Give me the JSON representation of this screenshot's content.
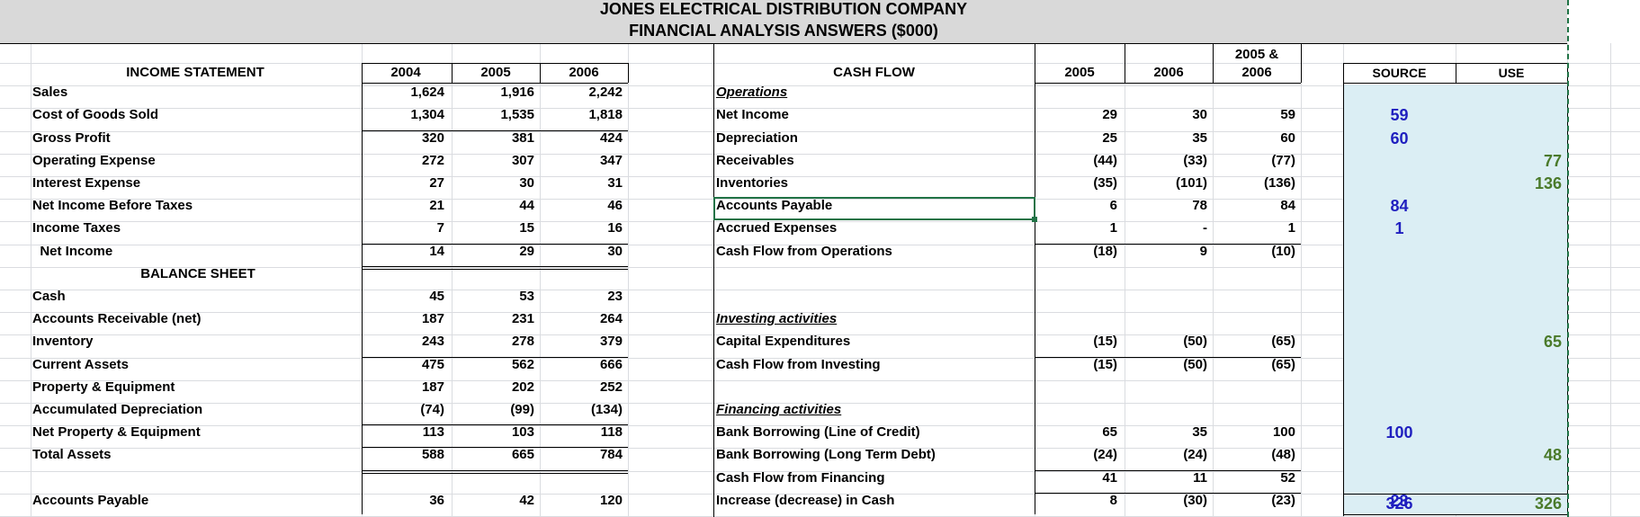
{
  "header": {
    "line1": "JONES ELECTRICAL  DISTRIBUTION COMPANY",
    "line2": "FINANCIAL ANALYSIS ANSWERS ($000)"
  },
  "income": {
    "heading": "INCOME STATEMENT",
    "years": [
      "2004",
      "2005",
      "2006"
    ],
    "rows": [
      {
        "label": "Sales",
        "values": [
          "1,624",
          "1,916",
          "2,242"
        ]
      },
      {
        "label": "Cost of Goods Sold",
        "values": [
          "1,304",
          "1,535",
          "1,818"
        ]
      },
      {
        "label": "Gross Profit",
        "values": [
          "320",
          "381",
          "424"
        ]
      },
      {
        "label": "Operating Expense",
        "values": [
          "272",
          "307",
          "347"
        ]
      },
      {
        "label": "Interest Expense",
        "values": [
          "27",
          "30",
          "31"
        ]
      },
      {
        "label": "Net Income Before Taxes",
        "values": [
          "21",
          "44",
          "46"
        ]
      },
      {
        "label": "Income Taxes",
        "values": [
          "7",
          "15",
          "16"
        ]
      },
      {
        "label": "  Net Income",
        "values": [
          "14",
          "29",
          "30"
        ]
      }
    ]
  },
  "balance": {
    "heading": "BALANCE SHEET",
    "rows": [
      {
        "label": "Cash",
        "values": [
          "45",
          "53",
          "23"
        ]
      },
      {
        "label": "Accounts Receivable (net)",
        "values": [
          "187",
          "231",
          "264"
        ]
      },
      {
        "label": "Inventory",
        "values": [
          "243",
          "278",
          "379"
        ]
      },
      {
        "label": "Current Assets",
        "values": [
          "475",
          "562",
          "666"
        ]
      },
      {
        "label": "Property & Equipment",
        "values": [
          "187",
          "202",
          "252"
        ]
      },
      {
        "label": "Accumulated Depreciation",
        "values": [
          "(74)",
          "(99)",
          "(134)"
        ]
      },
      {
        "label": "Net Property & Equipment",
        "values": [
          "113",
          "103",
          "118"
        ]
      },
      {
        "label": "Total Assets",
        "values": [
          "588",
          "665",
          "784"
        ]
      },
      {
        "label": "",
        "values": [
          "",
          "",
          ""
        ]
      },
      {
        "label": "Accounts Payable",
        "values": [
          "36",
          "42",
          "120"
        ]
      }
    ]
  },
  "cashflow": {
    "heading": "CASH FLOW",
    "years": [
      "2005",
      "2006",
      "2005 &",
      "2006"
    ],
    "rows": [
      {
        "label": "Operations",
        "section": true,
        "values": [
          "",
          "",
          ""
        ],
        "source": "",
        "use": ""
      },
      {
        "label": "Net Income",
        "values": [
          "29",
          "30",
          "59"
        ],
        "source": "59",
        "use": ""
      },
      {
        "label": "Depreciation",
        "values": [
          "25",
          "35",
          "60"
        ],
        "source": "60",
        "use": ""
      },
      {
        "label": "Receivables",
        "values": [
          "(44)",
          "(33)",
          "(77)"
        ],
        "source": "",
        "use": "77"
      },
      {
        "label": "Inventories",
        "values": [
          "(35)",
          "(101)",
          "(136)"
        ],
        "source": "",
        "use": "136"
      },
      {
        "label": "Accounts Payable",
        "values": [
          "6",
          "78",
          "84"
        ],
        "source": "84",
        "use": ""
      },
      {
        "label": "Accrued Expenses",
        "values": [
          "1",
          "-",
          "1"
        ],
        "source": "1",
        "use": ""
      },
      {
        "label": "Cash Flow from Operations",
        "values": [
          "(18)",
          "9",
          "(10)"
        ],
        "source": "",
        "use": ""
      },
      {
        "label": "",
        "values": [
          "",
          "",
          ""
        ],
        "source": "",
        "use": ""
      },
      {
        "label": "",
        "values": [
          "",
          "",
          ""
        ],
        "source": "",
        "use": ""
      },
      {
        "label": "Investing activities",
        "section": true,
        "values": [
          "",
          "",
          ""
        ],
        "source": "",
        "use": ""
      },
      {
        "label": "Capital Expenditures",
        "values": [
          "(15)",
          "(50)",
          "(65)"
        ],
        "source": "",
        "use": "65"
      },
      {
        "label": "Cash Flow from Investing",
        "values": [
          "(15)",
          "(50)",
          "(65)"
        ],
        "source": "",
        "use": ""
      },
      {
        "label": "",
        "values": [
          "",
          "",
          ""
        ],
        "source": "",
        "use": ""
      },
      {
        "label": "Financing activities",
        "section": true,
        "values": [
          "",
          "",
          ""
        ],
        "source": "",
        "use": ""
      },
      {
        "label": "Bank Borrowing (Line of Credit)",
        "values": [
          "65",
          "35",
          "100"
        ],
        "source": "100",
        "use": ""
      },
      {
        "label": "Bank Borrowing (Long Term Debt)",
        "values": [
          "(24)",
          "(24)",
          "(48)"
        ],
        "source": "",
        "use": "48"
      },
      {
        "label": "Cash Flow from Financing",
        "values": [
          "41",
          "11",
          "52"
        ],
        "source": "",
        "use": ""
      },
      {
        "label": "Increase (decrease) in Cash",
        "values": [
          "8",
          "(30)",
          "(23)"
        ],
        "source": "23",
        "use": ""
      }
    ],
    "source_header": "SOURCE",
    "use_header": "USE",
    "source_total": "326",
    "use_total": "326"
  },
  "colors": {
    "source": "#1f1fbf",
    "use": "#4a7a2a",
    "panel": "#dbeef4",
    "selection": "#217346"
  }
}
